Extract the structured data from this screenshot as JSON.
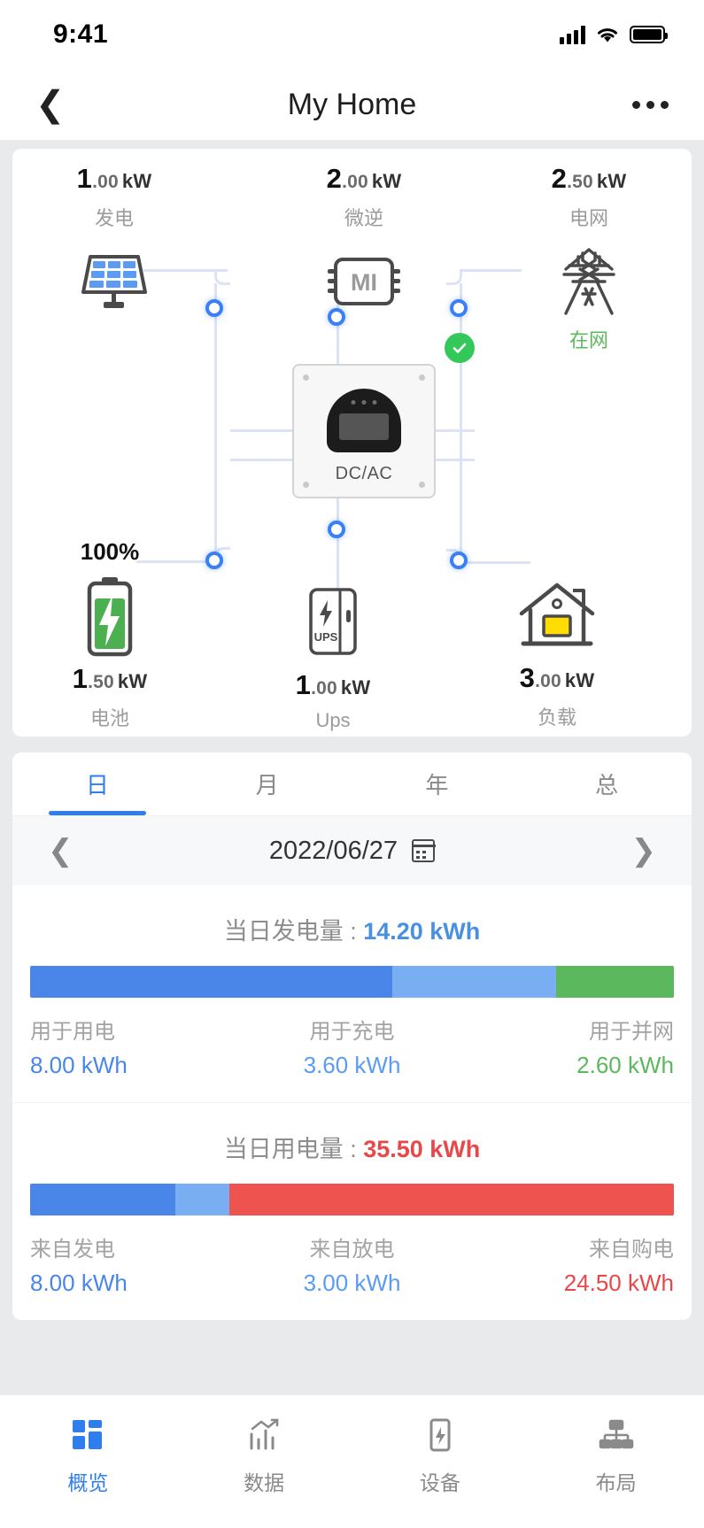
{
  "status_bar": {
    "time": "9:41",
    "signal_icon": "cellular-signal-icon",
    "wifi_icon": "wifi-icon",
    "battery_icon": "battery-icon"
  },
  "nav": {
    "back_icon": "chevron-left-icon",
    "title": "My Home",
    "more_icon": "more-options-icon"
  },
  "flow": {
    "pv": {
      "value": "1",
      "decimal": ".00",
      "unit": "kW",
      "label": "发电",
      "icon": "solar-panel-icon"
    },
    "mi": {
      "value": "2",
      "decimal": ".00",
      "unit": "kW",
      "label": "微逆",
      "icon": "microinverter-icon",
      "badge": "MI"
    },
    "grid": {
      "value": "2",
      "decimal": ".50",
      "unit": "kW",
      "label": "电网",
      "icon": "power-tower-icon",
      "status": "在网",
      "status_color": "#5cb85c"
    },
    "battery": {
      "percent": "100%",
      "value": "1",
      "decimal": ".50",
      "unit": "kW",
      "label": "电池",
      "icon": "battery-charging-icon"
    },
    "ups": {
      "value": "1",
      "decimal": ".00",
      "unit": "kW",
      "label": "Ups",
      "icon": "ups-cabinet-icon",
      "badge": "UPS"
    },
    "load": {
      "value": "3",
      "decimal": ".00",
      "unit": "kW",
      "label": "负载",
      "icon": "house-icon"
    },
    "inverter": {
      "caption": "DC/AC",
      "icon": "inverter-icon"
    },
    "grid_ok_icon": "check-circle-icon"
  },
  "stats": {
    "tabs": [
      {
        "label": "日",
        "active": true
      },
      {
        "label": "月",
        "active": false
      },
      {
        "label": "年",
        "active": false
      },
      {
        "label": "总",
        "active": false
      }
    ],
    "date": "2022/06/27",
    "prev_icon": "chevron-left-icon",
    "next_icon": "chevron-right-icon",
    "calendar_icon": "calendar-icon"
  },
  "chart_data": [
    {
      "type": "bar",
      "title": "当日发电量",
      "total": "14.20 kWh",
      "total_value": 14.2,
      "total_color": "#4a90e2",
      "unit": "kWh",
      "categories": [
        "用于用电",
        "用于充电",
        "用于并网"
      ],
      "values": [
        8.0,
        3.6,
        2.6
      ],
      "value_labels": [
        "8.00 kWh",
        "3.60 kWh",
        "2.60 kWh"
      ],
      "colors": [
        "#4a86e8",
        "#7aaef3",
        "#5cb85c"
      ],
      "percents": [
        56.3,
        25.4,
        18.3
      ]
    },
    {
      "type": "bar",
      "title": "当日用电量",
      "total": "35.50 kWh",
      "total_value": 35.5,
      "total_color": "#e8484a",
      "unit": "kWh",
      "categories": [
        "来自发电",
        "来自放电",
        "来自购电"
      ],
      "values": [
        8.0,
        3.0,
        24.5
      ],
      "value_labels": [
        "8.00 kWh",
        "3.00 kWh",
        "24.50 kWh"
      ],
      "colors": [
        "#4a86e8",
        "#7aaef3",
        "#ef5350"
      ],
      "percents": [
        22.5,
        8.5,
        69.0
      ]
    }
  ],
  "tabbar": [
    {
      "label": "概览",
      "icon": "overview-grid-icon",
      "active": true
    },
    {
      "label": "数据",
      "icon": "chart-bars-icon",
      "active": false
    },
    {
      "label": "设备",
      "icon": "device-icon",
      "active": false
    },
    {
      "label": "布局",
      "icon": "layout-tree-icon",
      "active": false
    }
  ],
  "colors": {
    "accent": "#2f7ef0",
    "green": "#5cb85c",
    "red": "#e8484a",
    "line": "#dbe3f5"
  }
}
